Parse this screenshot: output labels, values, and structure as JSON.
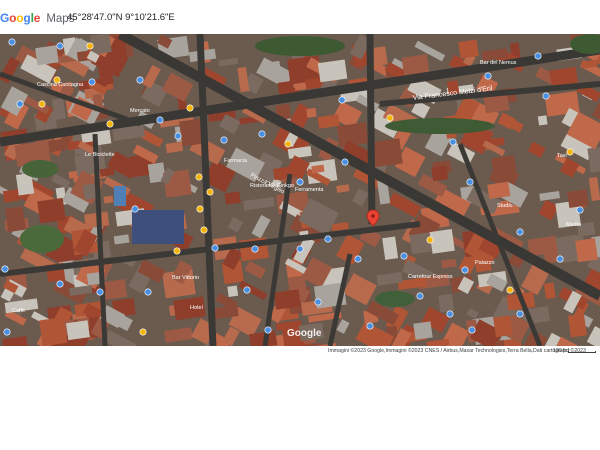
{
  "header": {
    "logo_letters": [
      "G",
      "o",
      "o",
      "g",
      "l",
      "e"
    ],
    "logo_colors": [
      "#4285F4",
      "#EA4335",
      "#FBBC05",
      "#4285F4",
      "#34A853",
      "#EA4335"
    ],
    "logo_suffix": "Maps",
    "coordinates": "45°28'47.0\"N 9°10'21.6\"E"
  },
  "map": {
    "view": "satellite",
    "watermark": "Google",
    "selected_pin_color": "#EA4335",
    "street_labels": [
      "Via Francesco Melzi d'Eril",
      "Piazza Virgilio"
    ],
    "place_labels": [
      "Carrefour Express",
      "Ristorante Ginkgo",
      "Farmacia",
      "Le Biciclette",
      "Bar del Nemus",
      "Cascina Cuccagna",
      "Ferramenta",
      "Mercato",
      "Taxi",
      "Media",
      "Bar Vittorio",
      "Studio",
      "Palazzo",
      "Hotel",
      "Caffè"
    ]
  },
  "footer": {
    "attribution": "Immagini ©2023 Google,Immagini ©2023 CNES / Airbus,Maxar Technologies,Terra Bella,Dati cartografici ©2023",
    "scale_label": "100 pd"
  }
}
